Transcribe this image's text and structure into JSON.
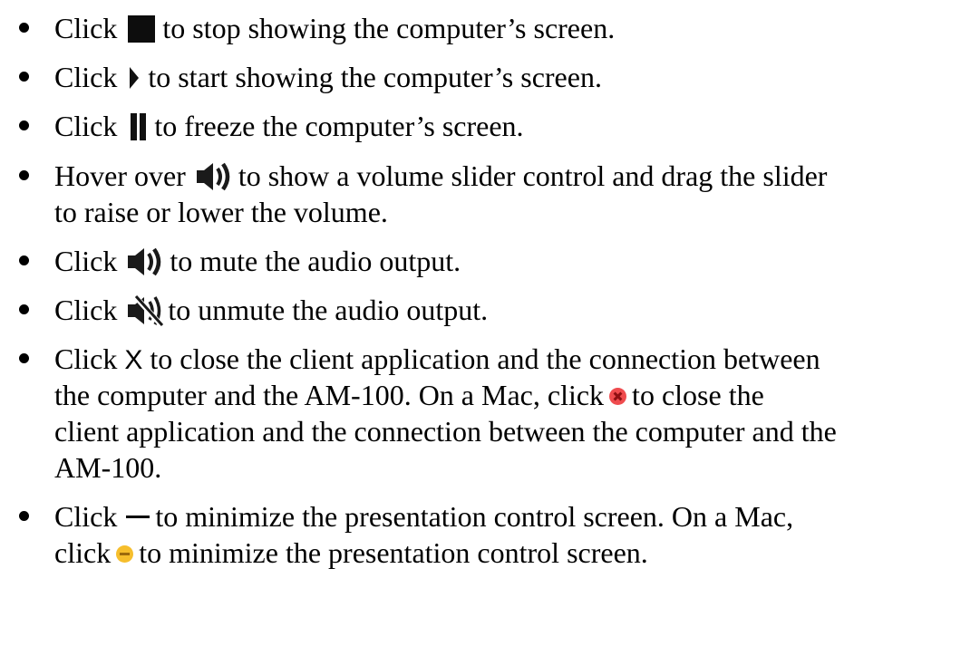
{
  "items": [
    {
      "pre": "Click",
      "icon": "stop-icon",
      "post": "to stop showing the computer’s screen."
    },
    {
      "pre": "Click",
      "icon": "play-icon",
      "post": "to start showing the computer’s screen."
    },
    {
      "pre": "Click",
      "icon": "pause-icon",
      "post": "to freeze the computer’s screen."
    },
    {
      "pre": "Hover over",
      "icon": "speaker-icon",
      "post": "to show a volume slider control and drag the slider",
      "line2": "to raise or lower the volume."
    },
    {
      "pre": "Click",
      "icon": "speaker-icon",
      "post": "to mute the audio output."
    },
    {
      "pre": "Click",
      "icon": "speaker-muted-icon",
      "post": "to unmute the audio output."
    },
    {
      "pre": "Click",
      "glyph": "X",
      "icon": "close-x-icon",
      "post": "to close the client application and the connection between",
      "line2_a": "the computer and the AM-100. On a Mac, click",
      "line2_icon": "mac-close-icon",
      "line2_b": "to close the",
      "line3": "client application and the connection between the computer and the",
      "line4": "AM-100."
    },
    {
      "pre": "Click",
      "icon": "minimize-dash-icon",
      "post": "to minimize the presentation control screen. On a Mac,",
      "line2_a": "click",
      "line2_icon": "mac-minimize-icon",
      "line2_b": "to minimize the presentation control screen."
    }
  ],
  "colors": {
    "text": "#000000",
    "mac_close": "#ef4b4e",
    "mac_minimize": "#f6be2c"
  }
}
